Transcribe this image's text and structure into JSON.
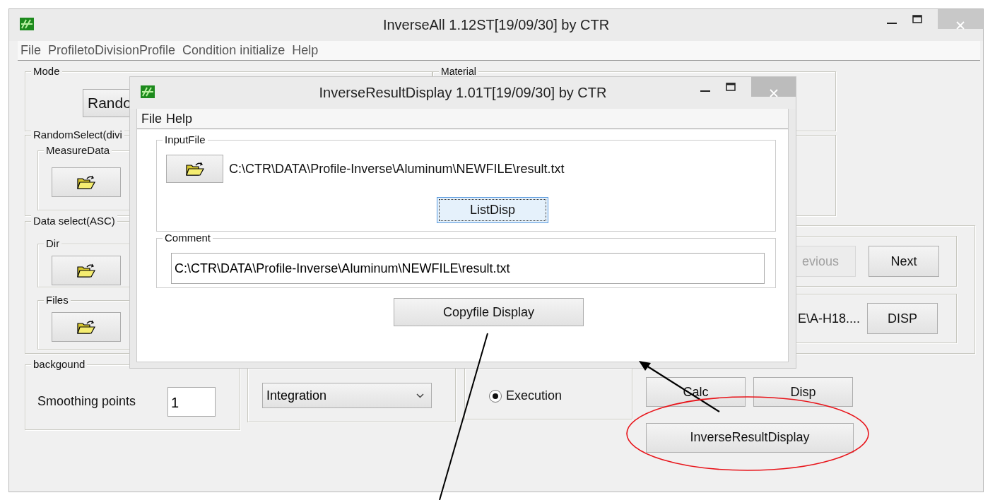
{
  "main_window": {
    "title": "InverseAll 1.12ST[19/09/30] by CTR",
    "menu": [
      "File",
      "ProfiletoDivisionProfile",
      "Condition initialize",
      "Help"
    ]
  },
  "mode": {
    "label": "Mode",
    "button": "Rando"
  },
  "material": {
    "label": "Material"
  },
  "random_select": {
    "label": "RandomSelect(divi",
    "measure_data": {
      "label": "MeasureData"
    }
  },
  "data_select": {
    "label": "Data select(ASC)",
    "dir": {
      "label": "Dir"
    },
    "files": {
      "label": "Files"
    }
  },
  "navigation": [
    {
      "label": "evious",
      "disabled": true
    },
    {
      "label": "Next",
      "disabled": false
    }
  ],
  "display": {
    "path": "E\\A-H18....",
    "button": "DISP"
  },
  "background": {
    "label": "backgound",
    "smoothing_label": "Smoothing points",
    "smoothing_value": "1"
  },
  "peak_integration": {
    "value": "Integration"
  },
  "standardization": {
    "option": {
      "label": "Execution",
      "selected": true
    }
  },
  "actions": [
    "Calc",
    "Disp",
    "InverseResultDisplay"
  ],
  "dialog": {
    "title": "InverseResultDisplay 1.01T[19/09/30] by CTR",
    "menu": [
      "File",
      "Help"
    ],
    "input_file": {
      "label": "InputFile",
      "path": "C:\\CTR\\DATA\\Profile-Inverse\\Aluminum\\NEWFILE\\result.txt",
      "button": {
        "label": "ListDisp",
        "focused": true
      }
    },
    "comment": {
      "label": "Comment",
      "value": "C:\\CTR\\DATA\\Profile-Inverse\\Aluminum\\NEWFILE\\result.txt"
    },
    "button": "Copyfile Display"
  }
}
